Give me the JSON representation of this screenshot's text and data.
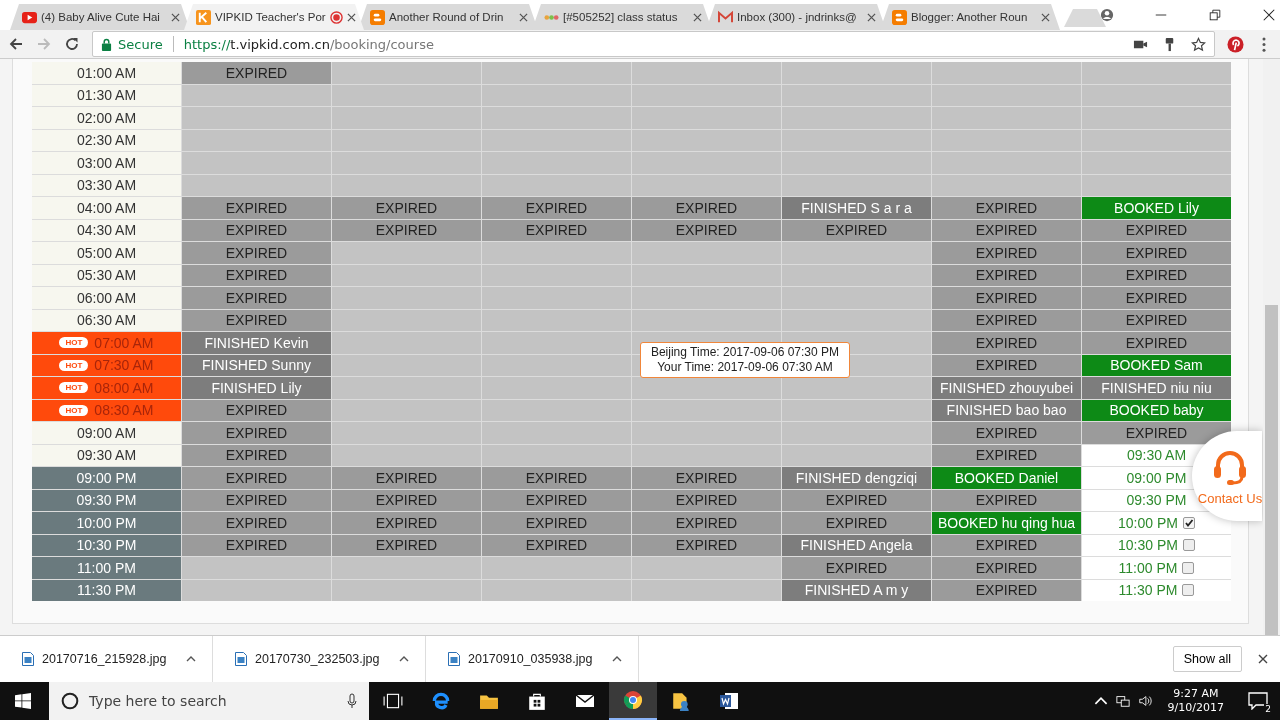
{
  "browser": {
    "tabs": [
      {
        "title": "(4) Baby Alive Cute Hai",
        "selected": false,
        "recording": false
      },
      {
        "title": "VIPKID Teacher's Por",
        "selected": true,
        "recording": true
      },
      {
        "title": "Another Round of Drin",
        "selected": false,
        "recording": false
      },
      {
        "title": "[#505252] class status",
        "selected": false,
        "recording": false
      },
      {
        "title": "Inbox (300) - jndrinks@",
        "selected": false,
        "recording": false
      },
      {
        "title": "Blogger: Another Roun",
        "selected": false,
        "recording": false
      }
    ],
    "address": {
      "secure_label": "Secure",
      "scheme": "https://",
      "host": "t.vipkid.com.cn",
      "path": "/booking/course"
    }
  },
  "schedule": {
    "rows": [
      {
        "time": "01:00 AM",
        "kind": "normal",
        "cells": [
          {
            "kind": "expired",
            "text": "EXPIRED"
          },
          {
            "kind": "empty"
          },
          {
            "kind": "empty"
          },
          {
            "kind": "empty"
          },
          {
            "kind": "empty"
          },
          {
            "kind": "empty"
          },
          {
            "kind": "empty"
          }
        ]
      },
      {
        "time": "01:30 AM",
        "kind": "normal",
        "cells": [
          {
            "kind": "empty"
          },
          {
            "kind": "empty"
          },
          {
            "kind": "empty"
          },
          {
            "kind": "empty"
          },
          {
            "kind": "empty"
          },
          {
            "kind": "empty"
          },
          {
            "kind": "empty"
          }
        ]
      },
      {
        "time": "02:00 AM",
        "kind": "normal",
        "cells": [
          {
            "kind": "empty"
          },
          {
            "kind": "empty"
          },
          {
            "kind": "empty"
          },
          {
            "kind": "empty"
          },
          {
            "kind": "empty"
          },
          {
            "kind": "empty"
          },
          {
            "kind": "empty"
          }
        ]
      },
      {
        "time": "02:30 AM",
        "kind": "normal",
        "cells": [
          {
            "kind": "empty"
          },
          {
            "kind": "empty"
          },
          {
            "kind": "empty"
          },
          {
            "kind": "empty"
          },
          {
            "kind": "empty"
          },
          {
            "kind": "empty"
          },
          {
            "kind": "empty"
          }
        ]
      },
      {
        "time": "03:00 AM",
        "kind": "normal",
        "cells": [
          {
            "kind": "empty"
          },
          {
            "kind": "empty"
          },
          {
            "kind": "empty"
          },
          {
            "kind": "empty"
          },
          {
            "kind": "empty"
          },
          {
            "kind": "empty"
          },
          {
            "kind": "empty"
          }
        ]
      },
      {
        "time": "03:30 AM",
        "kind": "normal",
        "cells": [
          {
            "kind": "empty"
          },
          {
            "kind": "empty"
          },
          {
            "kind": "empty"
          },
          {
            "kind": "empty"
          },
          {
            "kind": "empty"
          },
          {
            "kind": "empty"
          },
          {
            "kind": "empty"
          }
        ]
      },
      {
        "time": "04:00 AM",
        "kind": "normal",
        "cells": [
          {
            "kind": "expired",
            "text": "EXPIRED"
          },
          {
            "kind": "expired",
            "text": "EXPIRED"
          },
          {
            "kind": "expired",
            "text": "EXPIRED"
          },
          {
            "kind": "expired",
            "text": "EXPIRED"
          },
          {
            "kind": "finished",
            "text": "FINISHED S a r a"
          },
          {
            "kind": "expired",
            "text": "EXPIRED"
          },
          {
            "kind": "booked",
            "text": "BOOKED Lily"
          }
        ]
      },
      {
        "time": "04:30 AM",
        "kind": "normal",
        "cells": [
          {
            "kind": "expired",
            "text": "EXPIRED"
          },
          {
            "kind": "expired",
            "text": "EXPIRED"
          },
          {
            "kind": "expired",
            "text": "EXPIRED"
          },
          {
            "kind": "expired",
            "text": "EXPIRED"
          },
          {
            "kind": "expired",
            "text": "EXPIRED"
          },
          {
            "kind": "expired",
            "text": "EXPIRED"
          },
          {
            "kind": "expired",
            "text": "EXPIRED"
          }
        ]
      },
      {
        "time": "05:00 AM",
        "kind": "normal",
        "cells": [
          {
            "kind": "expired",
            "text": "EXPIRED"
          },
          {
            "kind": "empty"
          },
          {
            "kind": "empty"
          },
          {
            "kind": "empty"
          },
          {
            "kind": "empty"
          },
          {
            "kind": "expired",
            "text": "EXPIRED"
          },
          {
            "kind": "expired",
            "text": "EXPIRED"
          }
        ]
      },
      {
        "time": "05:30 AM",
        "kind": "normal",
        "cells": [
          {
            "kind": "expired",
            "text": "EXPIRED"
          },
          {
            "kind": "empty"
          },
          {
            "kind": "empty"
          },
          {
            "kind": "empty"
          },
          {
            "kind": "empty"
          },
          {
            "kind": "expired",
            "text": "EXPIRED"
          },
          {
            "kind": "expired",
            "text": "EXPIRED"
          }
        ]
      },
      {
        "time": "06:00 AM",
        "kind": "normal",
        "cells": [
          {
            "kind": "expired",
            "text": "EXPIRED"
          },
          {
            "kind": "empty"
          },
          {
            "kind": "empty"
          },
          {
            "kind": "empty"
          },
          {
            "kind": "empty"
          },
          {
            "kind": "expired",
            "text": "EXPIRED"
          },
          {
            "kind": "expired",
            "text": "EXPIRED"
          }
        ]
      },
      {
        "time": "06:30 AM",
        "kind": "normal",
        "cells": [
          {
            "kind": "expired",
            "text": "EXPIRED"
          },
          {
            "kind": "empty"
          },
          {
            "kind": "empty"
          },
          {
            "kind": "empty"
          },
          {
            "kind": "empty"
          },
          {
            "kind": "expired",
            "text": "EXPIRED"
          },
          {
            "kind": "expired",
            "text": "EXPIRED"
          }
        ]
      },
      {
        "time": "07:00 AM",
        "kind": "hot",
        "badge": "HOT",
        "cells": [
          {
            "kind": "finished",
            "text": "FINISHED Kevin"
          },
          {
            "kind": "empty"
          },
          {
            "kind": "empty"
          },
          {
            "kind": "empty"
          },
          {
            "kind": "empty"
          },
          {
            "kind": "expired",
            "text": "EXPIRED"
          },
          {
            "kind": "expired",
            "text": "EXPIRED"
          }
        ]
      },
      {
        "time": "07:30 AM",
        "kind": "hot",
        "badge": "HOT",
        "cells": [
          {
            "kind": "finished",
            "text": "FINISHED Sunny"
          },
          {
            "kind": "empty"
          },
          {
            "kind": "empty"
          },
          {
            "kind": "empty"
          },
          {
            "kind": "empty"
          },
          {
            "kind": "expired",
            "text": "EXPIRED"
          },
          {
            "kind": "booked",
            "text": "BOOKED Sam"
          }
        ]
      },
      {
        "time": "08:00 AM",
        "kind": "hot",
        "badge": "HOT",
        "cells": [
          {
            "kind": "finished",
            "text": "FINISHED Lily"
          },
          {
            "kind": "empty"
          },
          {
            "kind": "empty"
          },
          {
            "kind": "empty"
          },
          {
            "kind": "empty"
          },
          {
            "kind": "finished",
            "text": "FINISHED zhouyubei"
          },
          {
            "kind": "finished",
            "text": "FINISHED niu niu"
          }
        ]
      },
      {
        "time": "08:30 AM",
        "kind": "hot",
        "badge": "HOT",
        "cells": [
          {
            "kind": "expired",
            "text": "EXPIRED"
          },
          {
            "kind": "empty"
          },
          {
            "kind": "empty"
          },
          {
            "kind": "empty"
          },
          {
            "kind": "empty"
          },
          {
            "kind": "finished",
            "text": "FINISHED bao bao"
          },
          {
            "kind": "booked",
            "text": "BOOKED baby"
          }
        ]
      },
      {
        "time": "09:00 AM",
        "kind": "normal",
        "cells": [
          {
            "kind": "expired",
            "text": "EXPIRED"
          },
          {
            "kind": "empty"
          },
          {
            "kind": "empty"
          },
          {
            "kind": "empty"
          },
          {
            "kind": "empty"
          },
          {
            "kind": "expired",
            "text": "EXPIRED"
          },
          {
            "kind": "expired",
            "text": "EXPIRED"
          }
        ]
      },
      {
        "time": "09:30 AM",
        "kind": "normal",
        "cells": [
          {
            "kind": "expired",
            "text": "EXPIRED"
          },
          {
            "kind": "empty"
          },
          {
            "kind": "empty"
          },
          {
            "kind": "empty"
          },
          {
            "kind": "empty"
          },
          {
            "kind": "expired",
            "text": "EXPIRED"
          },
          {
            "kind": "open",
            "text": "09:30 AM"
          }
        ]
      },
      {
        "time": "09:00 PM",
        "kind": "pm",
        "cells": [
          {
            "kind": "expired",
            "text": "EXPIRED"
          },
          {
            "kind": "expired",
            "text": "EXPIRED"
          },
          {
            "kind": "expired",
            "text": "EXPIRED"
          },
          {
            "kind": "expired",
            "text": "EXPIRED"
          },
          {
            "kind": "finished",
            "text": "FINISHED dengziqi"
          },
          {
            "kind": "booked",
            "text": "BOOKED Daniel"
          },
          {
            "kind": "open",
            "text": "09:00 PM"
          }
        ]
      },
      {
        "time": "09:30 PM",
        "kind": "pm",
        "cells": [
          {
            "kind": "expired",
            "text": "EXPIRED"
          },
          {
            "kind": "expired",
            "text": "EXPIRED"
          },
          {
            "kind": "expired",
            "text": "EXPIRED"
          },
          {
            "kind": "expired",
            "text": "EXPIRED"
          },
          {
            "kind": "expired",
            "text": "EXPIRED"
          },
          {
            "kind": "expired",
            "text": "EXPIRED"
          },
          {
            "kind": "open",
            "text": "09:30 PM"
          }
        ]
      },
      {
        "time": "10:00 PM",
        "kind": "pm",
        "cells": [
          {
            "kind": "expired",
            "text": "EXPIRED"
          },
          {
            "kind": "expired",
            "text": "EXPIRED"
          },
          {
            "kind": "expired",
            "text": "EXPIRED"
          },
          {
            "kind": "expired",
            "text": "EXPIRED"
          },
          {
            "kind": "expired",
            "text": "EXPIRED"
          },
          {
            "kind": "booked",
            "text": "BOOKED hu qing hua"
          },
          {
            "kind": "open",
            "text": "10:00 PM",
            "checked": true
          }
        ]
      },
      {
        "time": "10:30 PM",
        "kind": "pm",
        "cells": [
          {
            "kind": "expired",
            "text": "EXPIRED"
          },
          {
            "kind": "expired",
            "text": "EXPIRED"
          },
          {
            "kind": "expired",
            "text": "EXPIRED"
          },
          {
            "kind": "expired",
            "text": "EXPIRED"
          },
          {
            "kind": "finished",
            "text": "FINISHED Angela"
          },
          {
            "kind": "expired",
            "text": "EXPIRED"
          },
          {
            "kind": "open",
            "text": "10:30 PM",
            "checked": false
          }
        ]
      },
      {
        "time": "11:00 PM",
        "kind": "pm",
        "cells": [
          {
            "kind": "empty"
          },
          {
            "kind": "empty"
          },
          {
            "kind": "empty"
          },
          {
            "kind": "empty"
          },
          {
            "kind": "expired",
            "text": "EXPIRED"
          },
          {
            "kind": "expired",
            "text": "EXPIRED"
          },
          {
            "kind": "open",
            "text": "11:00 PM",
            "checked": false
          }
        ]
      },
      {
        "time": "11:30 PM",
        "kind": "pm",
        "cells": [
          {
            "kind": "empty"
          },
          {
            "kind": "empty"
          },
          {
            "kind": "empty"
          },
          {
            "kind": "empty"
          },
          {
            "kind": "finished",
            "text": "FINISHED A m y"
          },
          {
            "kind": "expired",
            "text": "EXPIRED"
          },
          {
            "kind": "open",
            "text": "11:30 PM",
            "checked": false
          }
        ]
      }
    ],
    "tooltip": {
      "lines": [
        "Beijing Time: 2017-09-06 07:30 PM",
        "Your Time: 2017-09-06 07:30 AM"
      ]
    }
  },
  "contact": {
    "label": "Contact Us"
  },
  "downloads": {
    "items": [
      {
        "name": "20170716_215928.jpg"
      },
      {
        "name": "20170730_232503.jpg"
      },
      {
        "name": "20170910_035938.jpg"
      }
    ],
    "show_all": "Show all"
  },
  "taskbar": {
    "search_placeholder": "Type here to search",
    "time": "9:27 AM",
    "date": "9/10/2017",
    "notifications": "2"
  }
}
